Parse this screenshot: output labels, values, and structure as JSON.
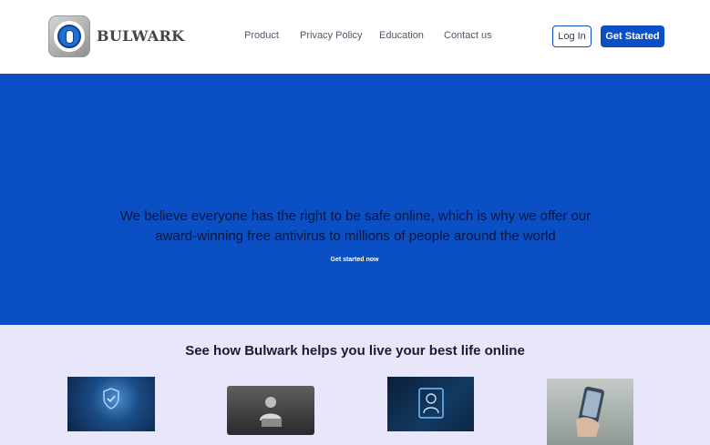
{
  "brand": {
    "name": "BULWARK",
    "logo_icon": "shield-keyhole-icon"
  },
  "nav": {
    "items": [
      {
        "label": "Product"
      },
      {
        "label": "Privacy Policy"
      },
      {
        "label": "Education"
      },
      {
        "label": "Contact us"
      }
    ]
  },
  "auth": {
    "login_label": "Log In",
    "get_started_label": "Get Started"
  },
  "hero": {
    "text": "We believe everyone has the right to be safe online, which is why we offer our award-winning free antivirus to millions of people around the world",
    "cta_label": "Get started now"
  },
  "section": {
    "title": "See how Bulwark helps you live your best life online",
    "images": [
      {
        "icon": "shield-hand-icon"
      },
      {
        "icon": "person-laptop-icon"
      },
      {
        "icon": "security-dashboard-icon"
      },
      {
        "icon": "phone-hand-icon"
      }
    ]
  },
  "colors": {
    "primary": "#0b4fc4",
    "header_bg": "#ffffff",
    "section_bg": "#e7e6fb",
    "hero_text": "#07173d"
  }
}
